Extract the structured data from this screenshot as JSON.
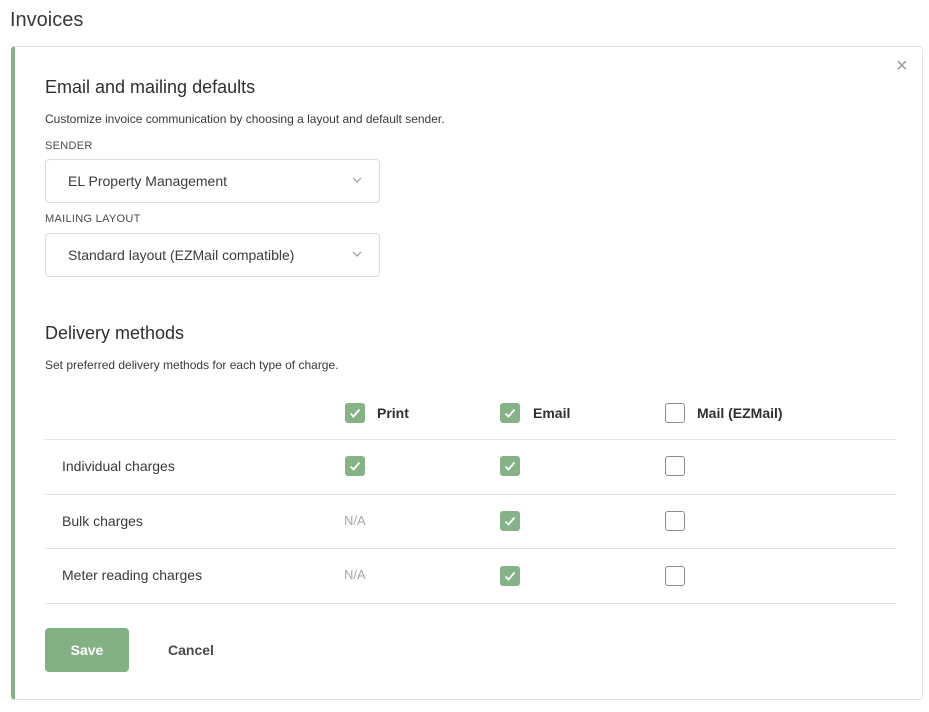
{
  "page": {
    "title": "Invoices"
  },
  "dialog": {
    "close_icon": "×"
  },
  "email_defaults": {
    "heading": "Email and mailing defaults",
    "description": "Customize invoice communication by choosing a layout and default sender.",
    "sender": {
      "label": "SENDER",
      "value": "EL Property Management"
    },
    "mailing_layout": {
      "label": "MAILING LAYOUT",
      "value": "Standard layout (EZMail compatible)"
    }
  },
  "delivery": {
    "heading": "Delivery methods",
    "description": "Set preferred delivery methods for each type of charge.",
    "columns": [
      {
        "label": "Print",
        "checked": true
      },
      {
        "label": "Email",
        "checked": true
      },
      {
        "label": "Mail (EZMail)",
        "checked": false
      }
    ],
    "rows": [
      {
        "label": "Individual charges",
        "print": "checked",
        "email": "checked",
        "mail": "unchecked"
      },
      {
        "label": "Bulk charges",
        "print": "N/A",
        "email": "checked",
        "mail": "unchecked"
      },
      {
        "label": "Meter reading charges",
        "print": "N/A",
        "email": "checked",
        "mail": "unchecked"
      }
    ]
  },
  "actions": {
    "save_label": "Save",
    "cancel_label": "Cancel"
  },
  "colors": {
    "accent": "#86b287",
    "checkbox_on": "#85b386",
    "save_button": "#82b184"
  }
}
